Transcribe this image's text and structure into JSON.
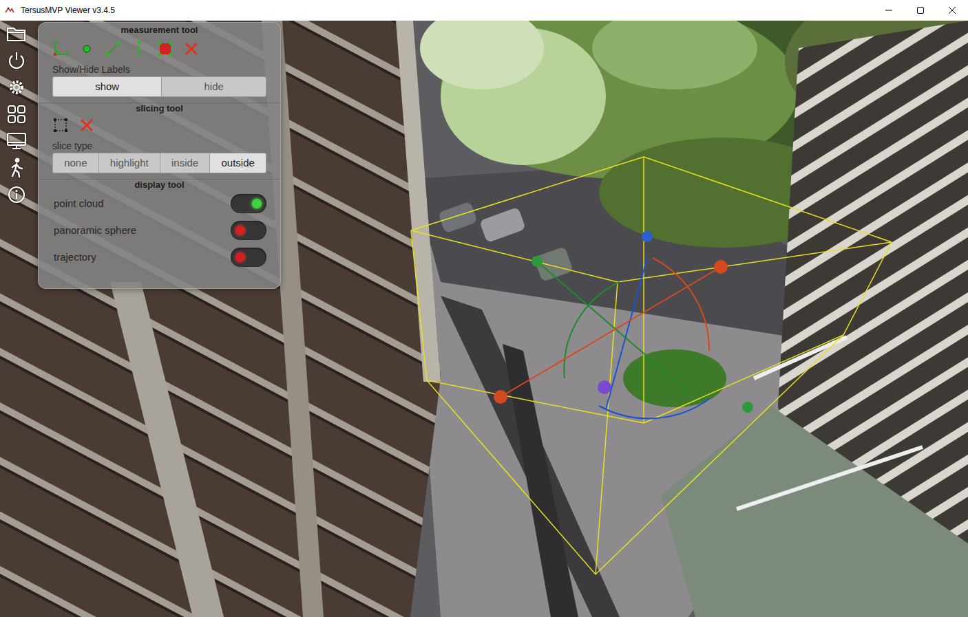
{
  "window": {
    "title": "TersusMVP Viewer v3.4.5"
  },
  "panel": {
    "measurement": {
      "title": "measurement tool",
      "labels_caption": "Show/Hide Labels",
      "label_options": [
        {
          "label": "show",
          "selected": true
        },
        {
          "label": "hide",
          "selected": false
        }
      ]
    },
    "slicing": {
      "title": "slicing tool",
      "slice_caption": "slice type",
      "slice_types": [
        {
          "label": "none",
          "selected": false
        },
        {
          "label": "highlight",
          "selected": false
        },
        {
          "label": "inside",
          "selected": false
        },
        {
          "label": "outside",
          "selected": true
        }
      ]
    },
    "display": {
      "title": "display tool",
      "toggles": [
        {
          "label": "point cloud",
          "on": true
        },
        {
          "label": "panoramic sphere",
          "on": false
        },
        {
          "label": "trajectory",
          "on": false
        }
      ]
    }
  }
}
